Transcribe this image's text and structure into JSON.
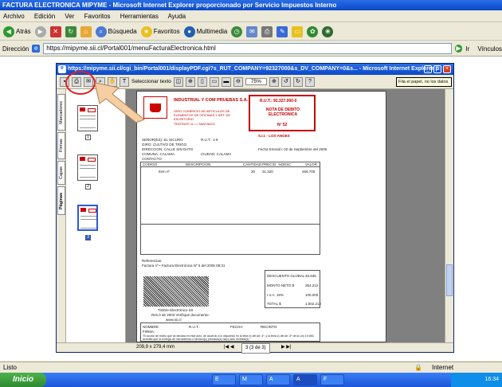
{
  "window": {
    "title": "FACTURA ELECTRONICA MIPYME - Microsoft Internet Explorer proporcionado por Servicio Impuestos Interno"
  },
  "menu": [
    "Archivo",
    "Edición",
    "Ver",
    "Favoritos",
    "Herramientas",
    "Ayuda"
  ],
  "toolbar": {
    "back": "Atrás",
    "search": "Búsqueda",
    "favorites": "Favoritos",
    "media": "Multimedia"
  },
  "address": {
    "label": "Dirección",
    "url": "https://mipyme.sii.cl/Portal001/menuFacturaElectronica.html",
    "go": "Ir",
    "links": "Vínculos"
  },
  "popup": {
    "title": "https://mipyme.sii.cl/cgi_bin/Portal001/displayPDF.cgi?s_RUT_COMPANY=92327000&s_DV_COMPANY=0&s... - Microsoft Internet Explorer p",
    "select_text": "Seleccionar texto",
    "zoom": "75%",
    "tooltip": "Fila el papel, no los datos",
    "tabs": [
      "Marcadores",
      "Firmas",
      "Capas",
      "Páginas"
    ],
    "thumb_numbers": [
      "1",
      "2",
      "3"
    ],
    "page_size": "209,9 x 279,4 mm",
    "page_nav": "3 (3 de 3)"
  },
  "invoice": {
    "company": "INDUSTRIAL Y COM PRUEBAS S.A.",
    "giro": "GIRO COMERCIO DE ARTICULOS DE ELEMENTOS DE OFICINAS Y ART. DE ESCRITORIO",
    "address": "TEATINOS 11 • • SANTIAGO",
    "rut": "R.U.T.: 92.327.000-0",
    "doc_type": "NOTA DE DEBITO ELECTRONICA",
    "number": "Nº 52",
    "office": "S.I.I. - LOS ANGES",
    "senores": "SEÑOR(ES): EL SICURO",
    "rut_r": "R.U.T.: 1-9",
    "giro_r": "GIRO: CULTIVO DE TRIGO",
    "direccion": "DIRECCION: CALLE SIN DATO",
    "comuna": "COMUNA: CALAMA",
    "ciudad": "CIUDAD: CALAMA",
    "contacto": "CONTACTO",
    "fecha": "Fecha Emisión: 02 de Septiembre del 2005",
    "cols": [
      "CODIGO",
      "DESCRIPCION",
      "CANTIDAD",
      "PRECIO",
      "%DESC",
      "VALOR"
    ],
    "item": {
      "desc": "Item nº",
      "qty": "30",
      "price": "31.320",
      "value": "456.705"
    },
    "ref_label": "Referencias:",
    "ref_text": "Factura nº • Factura Electrónica Nº 5 del 2005 08:31",
    "totals": [
      [
        "DESCUENTO GLOBAL",
        "45.535"
      ],
      [
        "MONTO NETO $",
        "354.212"
      ],
      [
        "I.V.A. 19%",
        "100.000"
      ],
      [
        "TOTAL $",
        "1.002.212"
      ]
    ],
    "timbre": "Timbre Electrónico SII",
    "res": "Res.0 de 2003 Verifique documento:",
    "www": "www.sii.cl",
    "sign": [
      "NOMBRE:",
      "R.U.T.:",
      "FECHA:",
      "RECINTO:",
      "FIRMA:"
    ],
    "legal": "\"El acuse de recibo que se declara en este acto, de acuerdo a lo dispuesto en la letra b) del Art. 4º, y la letra c) del Art. 5º de la Ley 19.983, acredita que la entrega de mercaderías o servicio(s) prestado(s) ha(n) sido recibido(s).\""
  },
  "status": {
    "left": "Listo",
    "zone": "Internet"
  },
  "taskbar": {
    "start": "Inicio",
    "buttons": [
      "E",
      "M",
      "A",
      "A",
      "F"
    ],
    "clock": "16:34"
  },
  "colors": {
    "title_blue": "#0a48c8",
    "invoice_red": "#c00000",
    "annotation": "#e02020",
    "arrow": "#f5cfa3"
  }
}
